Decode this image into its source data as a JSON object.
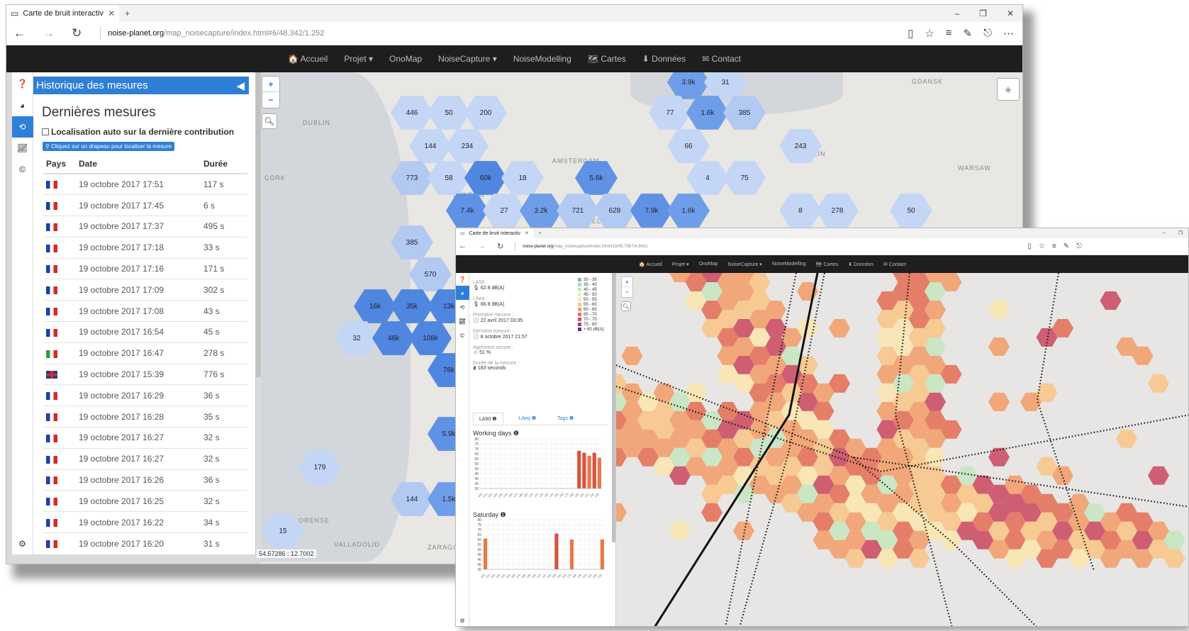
{
  "browser": {
    "tab_title": "Carte de bruit interactiv",
    "url_host": "noise-planet.org",
    "url_path": "/map_noisecapture/index.html#6/48.342/1.252"
  },
  "navbar": [
    "🏠 Accueil",
    "Projet ▾",
    "OnoMap",
    "NoiseCapture ▾",
    "NoiseModelling",
    "🗺 Cartes",
    "⬇ Données",
    "✉ Contact"
  ],
  "panel": {
    "header": "Historique des mesures",
    "title": "Dernières mesures",
    "checkbox_label": "Localisation auto sur la dernière contribution",
    "hint": "Cliquez sur un drapeau pour localiser la mesure",
    "columns": [
      "Pays",
      "Date",
      "Durée"
    ],
    "rows": [
      {
        "flag": "fr",
        "date": "19 octobre 2017 17:51",
        "duration": "117 s"
      },
      {
        "flag": "fr",
        "date": "19 octobre 2017 17:45",
        "duration": "6 s"
      },
      {
        "flag": "fr",
        "date": "19 octobre 2017 17:37",
        "duration": "495 s"
      },
      {
        "flag": "fr",
        "date": "19 octobre 2017 17:18",
        "duration": "33 s"
      },
      {
        "flag": "fr",
        "date": "19 octobre 2017 17:16",
        "duration": "171 s"
      },
      {
        "flag": "fr",
        "date": "19 octobre 2017 17:09",
        "duration": "302 s"
      },
      {
        "flag": "fr",
        "date": "19 octobre 2017 17:08",
        "duration": "43 s"
      },
      {
        "flag": "fr",
        "date": "19 octobre 2017 16:54",
        "duration": "45 s"
      },
      {
        "flag": "it",
        "date": "19 octobre 2017 16:47",
        "duration": "278 s"
      },
      {
        "flag": "gb",
        "date": "19 octobre 2017 15:39",
        "duration": "776 s"
      },
      {
        "flag": "fr",
        "date": "19 octobre 2017 16:29",
        "duration": "36 s"
      },
      {
        "flag": "fr",
        "date": "19 octobre 2017 16:28",
        "duration": "35 s"
      },
      {
        "flag": "fr",
        "date": "19 octobre 2017 16:27",
        "duration": "32 s"
      },
      {
        "flag": "fr",
        "date": "19 octobre 2017 16:27",
        "duration": "32 s"
      },
      {
        "flag": "fr",
        "date": "19 octobre 2017 16:26",
        "duration": "36 s"
      },
      {
        "flag": "fr",
        "date": "19 octobre 2017 16:25",
        "duration": "32 s"
      },
      {
        "flag": "fr",
        "date": "19 octobre 2017 16:22",
        "duration": "34 s"
      },
      {
        "flag": "fr",
        "date": "19 octobre 2017 16:20",
        "duration": "31 s"
      }
    ]
  },
  "map1": {
    "coords": "54.57286 : 12.7002",
    "labels": [
      "DUBLIN",
      "AMSTERDAM",
      "BERLIN",
      "WARSAW",
      "BRUSSELS",
      "GDANSK",
      "LONDON",
      "VALLADOLID",
      "ZARAGOZA",
      "CORK",
      "ORENSE"
    ],
    "hexes": [
      {
        "v": "3.9k",
        "c": "#6f9ee8"
      },
      {
        "v": "31",
        "c": "#c4d6f5"
      },
      {
        "v": "446",
        "c": "#c4d6f5"
      },
      {
        "v": "50",
        "c": "#c4d6f5"
      },
      {
        "v": "200",
        "c": "#c4d6f5"
      },
      {
        "v": "77",
        "c": "#c4d6f5"
      },
      {
        "v": "1.6k",
        "c": "#6f9ee8"
      },
      {
        "v": "385",
        "c": "#b2c9f2"
      },
      {
        "v": "144",
        "c": "#c4d6f5"
      },
      {
        "v": "234",
        "c": "#c4d6f5"
      },
      {
        "v": "66",
        "c": "#c4d6f5"
      },
      {
        "v": "243",
        "c": "#c4d6f5"
      },
      {
        "v": "773",
        "c": "#b2c9f2"
      },
      {
        "v": "58",
        "c": "#c4d6f5"
      },
      {
        "v": "60k",
        "c": "#4f86e0"
      },
      {
        "v": "18",
        "c": "#c4d6f5"
      },
      {
        "v": "5.6k",
        "c": "#5f92e5"
      },
      {
        "v": "4",
        "c": "#c4d6f5"
      },
      {
        "v": "75",
        "c": "#c4d6f5"
      },
      {
        "v": "7.4k",
        "c": "#5f92e5"
      },
      {
        "v": "27",
        "c": "#c4d6f5"
      },
      {
        "v": "3.2k",
        "c": "#6f9ee8"
      },
      {
        "v": "721",
        "c": "#b2c9f2"
      },
      {
        "v": "628",
        "c": "#b2c9f2"
      },
      {
        "v": "7.9k",
        "c": "#5f92e5"
      },
      {
        "v": "1.6k",
        "c": "#6f9ee8"
      },
      {
        "v": "8",
        "c": "#c4d6f5"
      },
      {
        "v": "278",
        "c": "#c4d6f5"
      },
      {
        "v": "50",
        "c": "#c4d6f5"
      },
      {
        "v": "385",
        "c": "#b2c9f2"
      },
      {
        "v": "570",
        "c": "#b2c9f2"
      },
      {
        "v": "16k",
        "c": "#4f86e0"
      },
      {
        "v": "35k",
        "c": "#4f86e0"
      },
      {
        "v": "13k",
        "c": "#4f86e0"
      },
      {
        "v": "32",
        "c": "#c4d6f5"
      },
      {
        "v": "46k",
        "c": "#4f86e0"
      },
      {
        "v": "108k",
        "c": "#4f86e0"
      },
      {
        "v": "78k",
        "c": "#4f86e0"
      },
      {
        "v": "5.9k",
        "c": "#5f92e5"
      },
      {
        "v": "179",
        "c": "#c4d6f5"
      },
      {
        "v": "144",
        "c": "#b2c9f2"
      },
      {
        "v": "1.5k",
        "c": "#6f9ee8"
      },
      {
        "v": "15",
        "c": "#c4d6f5"
      }
    ]
  },
  "w2": {
    "url_host": "noise-planet.org",
    "url_path": "/map_noisecapture/index.html#18/45.7567/4.8431",
    "stats": [
      {
        "label": "LA50 :",
        "value": "🎙 62.8 dB(A)"
      },
      {
        "label": "LAeq :",
        "value": "🎙 66.8 dB(A)"
      },
      {
        "label": "Première mesure :",
        "value": "🕘 22 avril 2017 03:35"
      },
      {
        "label": "Dernière mesure :",
        "value": "🕘 8 octobre 2017 21:57"
      },
      {
        "label": "Agrément sonore :",
        "value": "☺ 51 %"
      },
      {
        "label": "Durée de la mesure :",
        "value": "⧗ 183 seconds"
      }
    ],
    "tabs": [
      "LA50 ❶",
      "LAeq ❶",
      "Tags ❶"
    ],
    "legend": [
      {
        "t": "30 - 35",
        "c": "#82b7b0"
      },
      {
        "t": "35 - 40",
        "c": "#a6d6c8"
      },
      {
        "t": "40 - 45",
        "c": "#c7e6c0"
      },
      {
        "t": "45 - 50",
        "c": "#e6f0c5"
      },
      {
        "t": "50 - 55",
        "c": "#fbe6b0"
      },
      {
        "t": "55 - 60",
        "c": "#f8c78a"
      },
      {
        "t": "60 - 65",
        "c": "#f2a06d"
      },
      {
        "t": "65 - 70",
        "c": "#e4725a"
      },
      {
        "t": "70 - 75",
        "c": "#cc4f66"
      },
      {
        "t": "75 - 80",
        "c": "#a23e7a"
      },
      {
        "t": "> 80 dB(A)",
        "c": "#6b2d7a"
      }
    ],
    "chart_titles": [
      "Working days ❶",
      "Saturday ❶"
    ]
  },
  "chart_data": [
    {
      "type": "bar",
      "title": "Working days",
      "ylim": [
        30,
        80
      ],
      "yticks": [
        80,
        75,
        70,
        65,
        60,
        55,
        50,
        45,
        40,
        35,
        30
      ],
      "x": [
        "00h",
        "01h",
        "02h",
        "03h",
        "04h",
        "05h",
        "06h",
        "07h",
        "08h",
        "09h",
        "10h",
        "11h",
        "12h",
        "13h",
        "14h",
        "15h",
        "16h",
        "17h",
        "18h",
        "19h",
        "20h",
        "21h",
        "22h",
        "23h"
      ],
      "values": [
        null,
        null,
        null,
        null,
        null,
        null,
        null,
        null,
        null,
        null,
        null,
        null,
        null,
        null,
        null,
        null,
        null,
        null,
        null,
        68,
        66,
        63,
        66,
        61
      ]
    },
    {
      "type": "bar",
      "title": "Saturday",
      "ylim": [
        30,
        80
      ],
      "yticks": [
        80,
        75,
        70,
        65,
        60,
        55,
        50,
        45,
        40,
        35,
        30
      ],
      "x": [
        "00h",
        "01h",
        "02h",
        "03h",
        "04h",
        "05h",
        "06h",
        "07h",
        "08h",
        "09h",
        "10h",
        "11h",
        "12h",
        "13h",
        "14h",
        "15h",
        "16h",
        "17h",
        "18h",
        "19h",
        "20h",
        "21h",
        "22h",
        "23h"
      ],
      "values": [
        61,
        null,
        null,
        null,
        null,
        null,
        null,
        null,
        null,
        null,
        null,
        null,
        null,
        null,
        66,
        null,
        null,
        60,
        null,
        null,
        null,
        null,
        null,
        60
      ]
    }
  ]
}
